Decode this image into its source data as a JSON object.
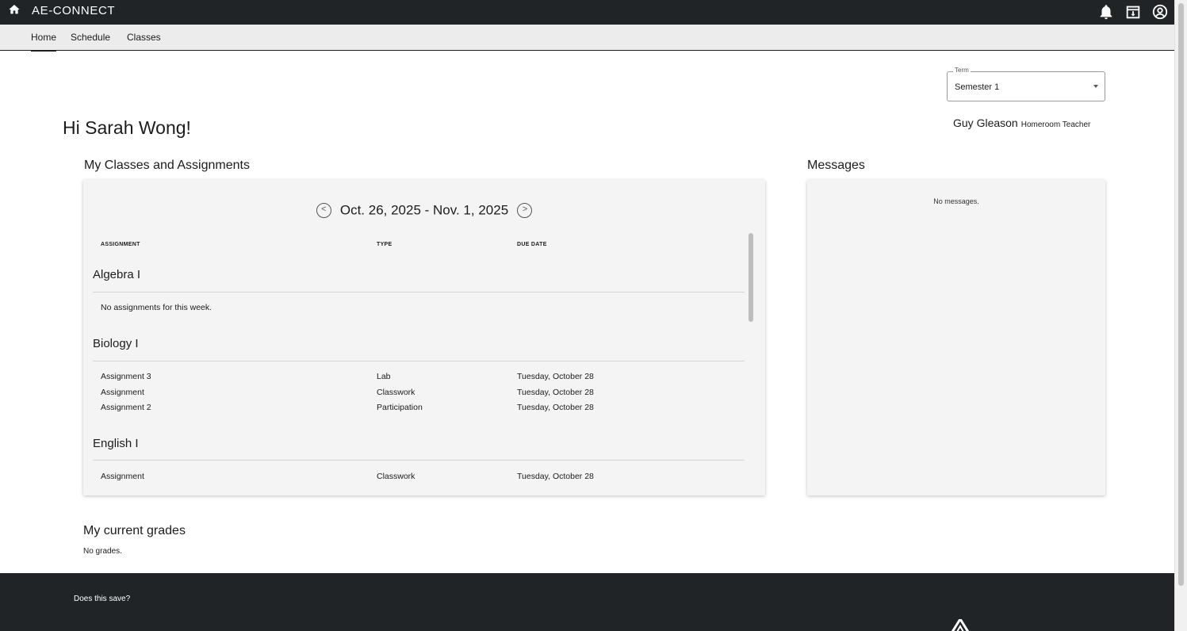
{
  "app": {
    "title": "AE-CONNECT"
  },
  "nav": {
    "tabs": [
      {
        "label": "Home"
      },
      {
        "label": "Schedule"
      },
      {
        "label": "Classes"
      }
    ]
  },
  "term": {
    "legend": "Term",
    "value": "Semester 1"
  },
  "greeting": "Hi Sarah Wong!",
  "teacher": {
    "name": "Guy Gleason",
    "role": "Homeroom Teacher"
  },
  "classes_section": {
    "heading": "My Classes and Assignments",
    "week_label": "Oct. 26, 2025 - Nov. 1, 2025",
    "columns": {
      "assignment": "ASSIGNMENT",
      "type": "TYPE",
      "due": "DUE DATE"
    },
    "groups": [
      {
        "name": "Algebra I",
        "empty": "No assignments for this week.",
        "rows": []
      },
      {
        "name": "Biology I",
        "rows": [
          {
            "assignment": "Assignment 3",
            "type": "Lab",
            "due": "Tuesday, October 28"
          },
          {
            "assignment": "Assignment",
            "type": "Classwork",
            "due": "Tuesday, October 28"
          },
          {
            "assignment": "Assignment 2",
            "type": "Participation",
            "due": "Tuesday, October 28"
          }
        ]
      },
      {
        "name": "English I",
        "rows": [
          {
            "assignment": "Assignment",
            "type": "Classwork",
            "due": "Tuesday, October 28"
          }
        ]
      }
    ]
  },
  "messages": {
    "heading": "Messages",
    "empty": "No messages."
  },
  "grades": {
    "heading": "My current grades",
    "empty": "No grades."
  },
  "footer": {
    "note": "Does this save?"
  },
  "icons": {
    "home": "home-icon",
    "notifications": "bell-icon",
    "archive": "download-box-icon",
    "account": "account-circle-icon",
    "prev": "chevron-left-circle-icon",
    "next": "chevron-right-circle-icon"
  }
}
